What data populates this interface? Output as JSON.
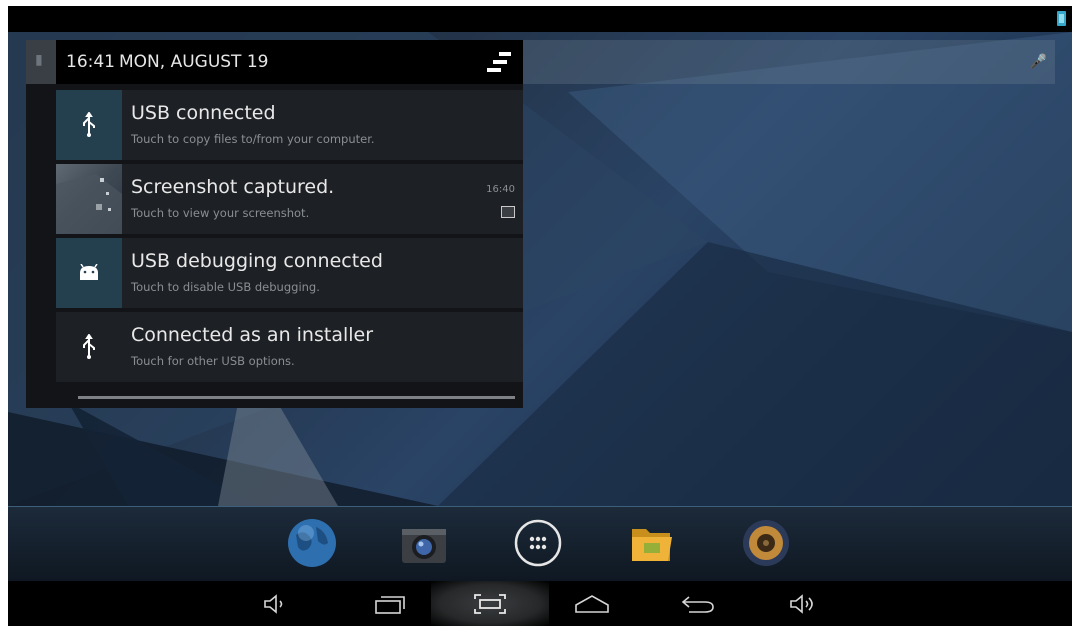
{
  "status_bar": {
    "time": "16:41",
    "date": "MON, AUGUST 19"
  },
  "notifications": [
    {
      "title": "USB connected",
      "subtitle": "Touch to copy files to/from your computer.",
      "icon": "usb-icon"
    },
    {
      "title": "Screenshot captured.",
      "subtitle": "Touch to view your screenshot.",
      "time": "16:40",
      "icon": "screenshot-thumbnail"
    },
    {
      "title": "USB debugging connected",
      "subtitle": "Touch to disable USB debugging.",
      "icon": "android-debug-icon"
    },
    {
      "title": "Connected as an installer",
      "subtitle": "Touch for other USB options.",
      "icon": "usb-icon"
    }
  ],
  "dock": [
    "browser-globe-icon",
    "camera-icon",
    "app-drawer-icon",
    "file-manager-folder-icon",
    "music-speaker-icon"
  ],
  "nav_buttons": [
    "volume-down-icon",
    "recent-apps-icon",
    "screenshot-icon",
    "home-icon",
    "back-icon",
    "volume-up-icon"
  ],
  "colors": {
    "accent": "#36a7c9",
    "notification_bg": "#1d2024",
    "teal_icon_bg": "#243f4e"
  }
}
